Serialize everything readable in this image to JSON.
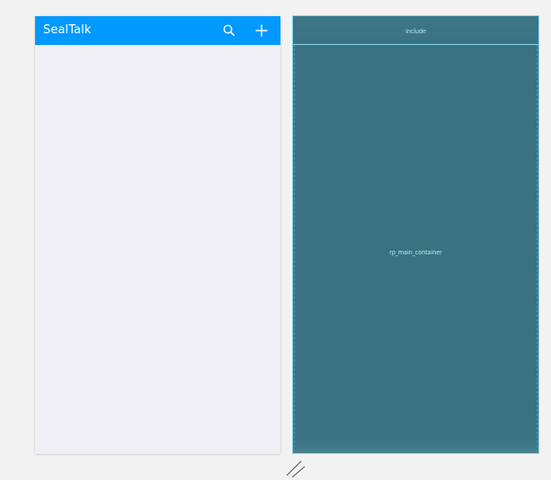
{
  "preview": {
    "app_title": "SealTalk",
    "toolbar_icons": [
      {
        "name": "search-icon"
      },
      {
        "name": "plus-icon"
      }
    ],
    "colors": {
      "toolbar": "#0099ff",
      "content_background": "#efeff4",
      "toolbar_text": "#ffffff"
    }
  },
  "blueprint": {
    "include_label": "include",
    "main_container_label": "rp_main_container",
    "colors": {
      "background": "#3a7282",
      "outline": "#7fd7ec",
      "label": "#bfeaf4"
    }
  },
  "canvas": {
    "background": "#f2f2f2",
    "resize_handle_icon": "resize-handle-icon"
  }
}
